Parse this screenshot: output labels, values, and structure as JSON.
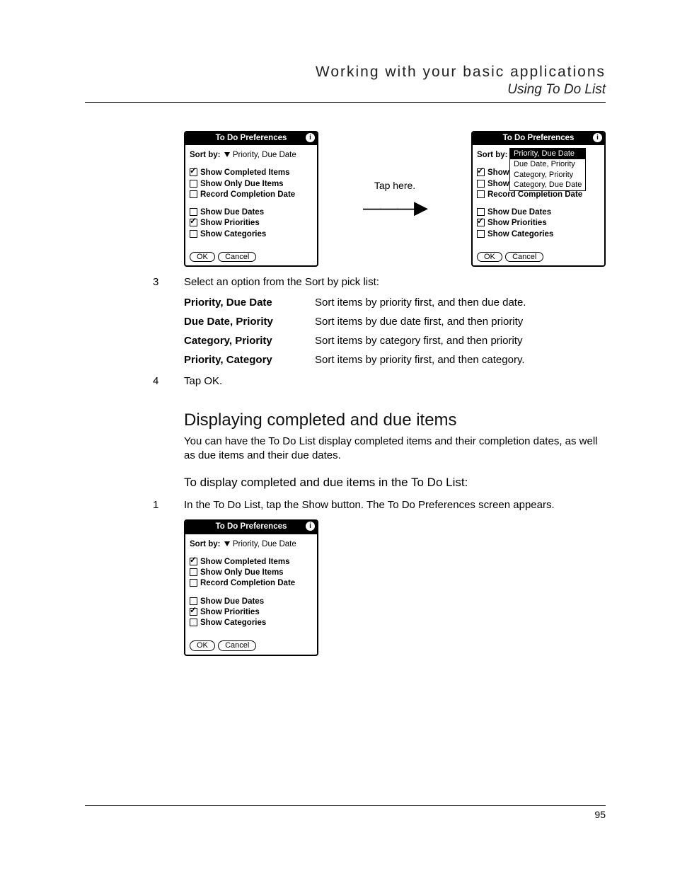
{
  "header": {
    "chapter": "Working with your basic applications",
    "section": "Using To Do List"
  },
  "footer": {
    "page": "95"
  },
  "fig_callout": "Tap here.",
  "palm": {
    "title": "To Do Preferences",
    "info_glyph": "i",
    "sort_label": "Sort by:",
    "sort_value": "Priority, Due Date",
    "cb": {
      "completed": "Show Completed Items",
      "only_due": "Show Only Due Items",
      "rec_date": "Record Completion Date",
      "due_dates": "Show Due Dates",
      "priorities": "Show Priorities",
      "categories": "Show Categories"
    },
    "ok": "OK",
    "cancel": "Cancel",
    "dropdown": {
      "o1": "Priority, Due Date",
      "o2": "Due Date, Priority",
      "o3": "Category, Priority",
      "o4": "Category, Due Date"
    },
    "show_short": "Show"
  },
  "step3": {
    "num": "3",
    "text": "Select an option from the Sort by pick list:"
  },
  "options": {
    "r1": {
      "label": "Priority, Due Date",
      "desc": "Sort items by priority first, and then due date."
    },
    "r2": {
      "label": "Due Date, Priority",
      "desc": "Sort items by due date first, and then priority"
    },
    "r3": {
      "label": "Category, Priority",
      "desc": "Sort items by category first, and then priority"
    },
    "r4": {
      "label": "Priority, Category",
      "desc": "Sort items by priority first, and then category."
    }
  },
  "step4": {
    "num": "4",
    "text": "Tap OK."
  },
  "sect2": {
    "heading": "Displaying completed and due items",
    "para": "You can have the To Do List display completed items and their completion dates, as well as due items and their due dates.",
    "subhead": "To display completed and due items in the To Do List:"
  },
  "step1": {
    "num": "1",
    "text": "In the To Do List, tap the Show button. The To Do Preferences screen appears."
  }
}
